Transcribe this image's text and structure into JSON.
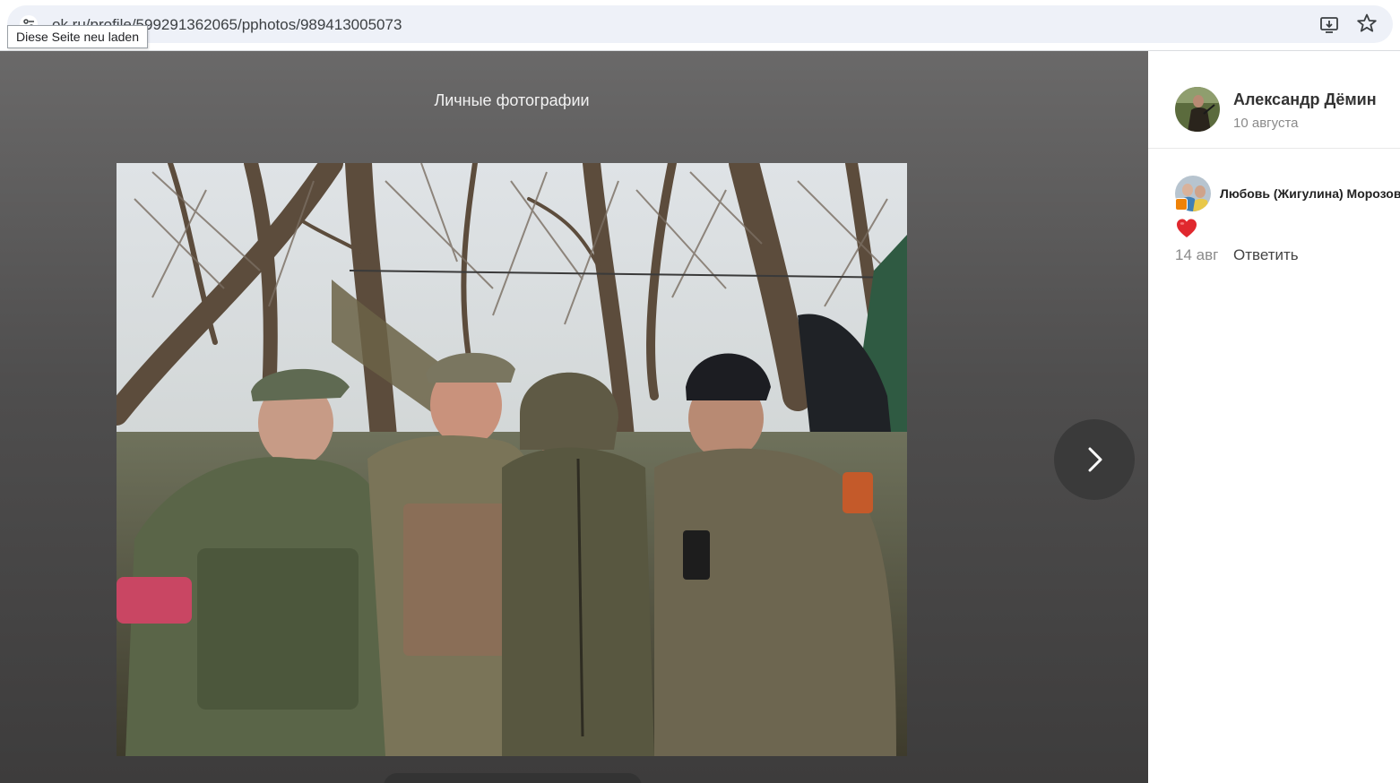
{
  "browser": {
    "url": "ok.ru/profile/599291362065/pphotos/989413005073",
    "tooltip": "Diese Seite neu laden",
    "icons": [
      "site-info-icon",
      "install-app-icon",
      "bookmark-star-icon"
    ]
  },
  "viewer": {
    "album_title": "Личные фотографии",
    "photo_description": "group-photo",
    "next_icon": "chevron-right-icon"
  },
  "side_panel": {
    "author": {
      "name": "Александр Дёмин",
      "date": "10 августа"
    },
    "comments": [
      {
        "author": "Любовь (Жигулина) Морозова",
        "reaction_icon": "heart-icon",
        "date": "14 авг",
        "reply_label": "Ответить"
      }
    ]
  },
  "colors": {
    "viewer_bg": "#4f4e4e",
    "accent_ok": "#ee8208",
    "heart": "#e0282e"
  }
}
